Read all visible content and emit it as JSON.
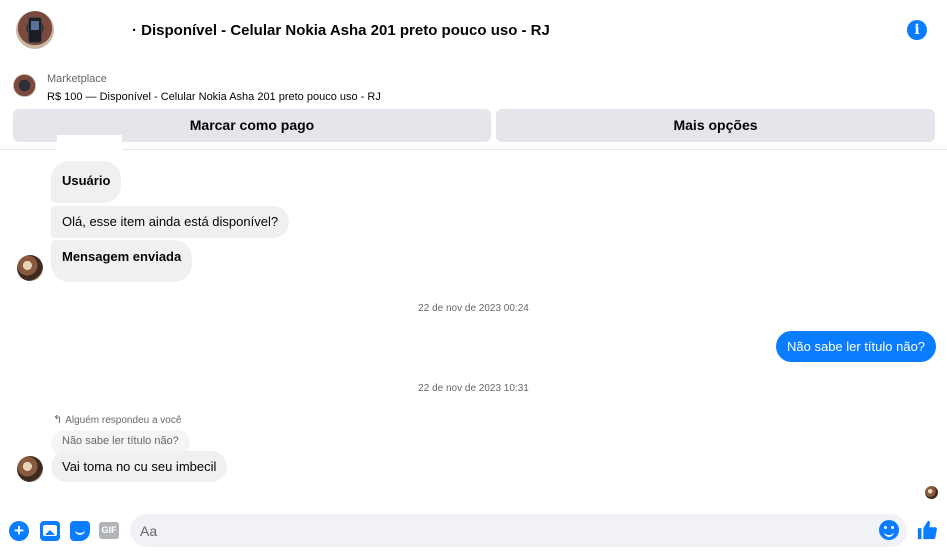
{
  "header": {
    "title": "· Disponível - Celular Nokia Asha 201 preto pouco uso - RJ",
    "info_icon": "info-icon"
  },
  "marketplace": {
    "label": "Marketplace",
    "listing": "R$ 100 — Disponível - Celular Nokia Asha 201 preto pouco uso - RJ"
  },
  "actions": {
    "mark_paid": "Marcar como pago",
    "more_options": "Mais opções"
  },
  "messages": {
    "user_label": "Usuário",
    "hello": "Olá, esse item ainda está disponível?",
    "sent_label": "Mensagem enviada",
    "timestamp_1": "22 de nov de 2023 00:24",
    "mine": "Não sabe ler título não?",
    "timestamp_2": "22 de nov de 2023 10:31",
    "reply_label": "Alguém respondeu a você",
    "reply_quote": "Não sabe ler título não?",
    "insult": "Vai toma no cu seu imbecil"
  },
  "composer": {
    "placeholder": "Aa",
    "gif_label": "GIF"
  },
  "colors": {
    "accent": "#0a7cff",
    "bubble_gray": "#f0f0f0",
    "button_gray": "#e4e6eb"
  }
}
